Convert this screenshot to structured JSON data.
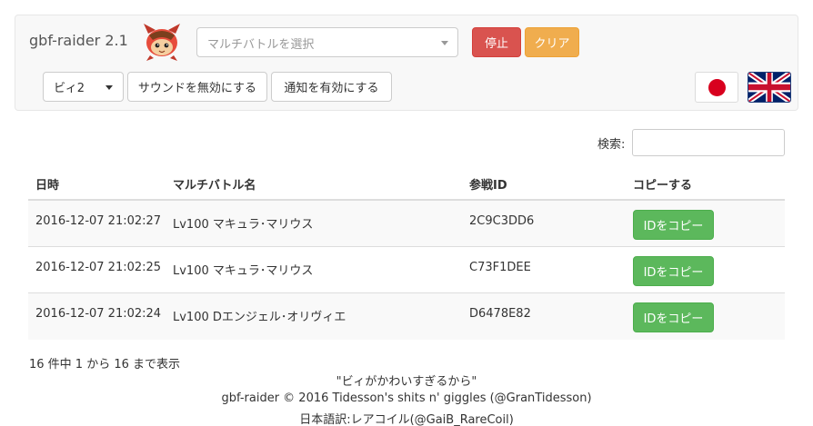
{
  "navbar": {
    "brand": "gbf-raider 2.1",
    "battle_select": {
      "placeholder": "マルチバトルを選択"
    },
    "stop_label": "停止",
    "clear_label": "クリア",
    "voice_select": "ビィ2",
    "sound_label": "サウンドを無効にする",
    "notify_label": "通知を有効にする",
    "colors": {
      "stop": "#d9534f",
      "clear": "#f0ad4e",
      "copy": "#5cb85c"
    }
  },
  "search": {
    "label": "検索:"
  },
  "table": {
    "headers": [
      "日時",
      "マルチバトル名",
      "参戦ID",
      "コピーする"
    ],
    "rows": [
      {
        "time": "2016-12-07 21:02:27",
        "name": "Lv100 マキュラ･マリウス",
        "id": "2C9C3DD6",
        "copy": "IDをコピー"
      },
      {
        "time": "2016-12-07 21:02:25",
        "name": "Lv100 マキュラ･マリウス",
        "id": "C73F1DEE",
        "copy": "IDをコピー"
      },
      {
        "time": "2016-12-07 21:02:24",
        "name": "Lv100 Dエンジェル･オリヴィエ",
        "id": "D6478E82",
        "copy": "IDをコピー"
      }
    ]
  },
  "info": "16 件中 1 から 16 まで表示",
  "footer": {
    "quote": "\"ビィがかわいすぎるから\"",
    "credit": "gbf-raider © 2016 Tidesson's shits n' giggles (@GranTidesson)",
    "translation": "日本語訳:レアコイル(@GaiB_RareCoil)"
  }
}
